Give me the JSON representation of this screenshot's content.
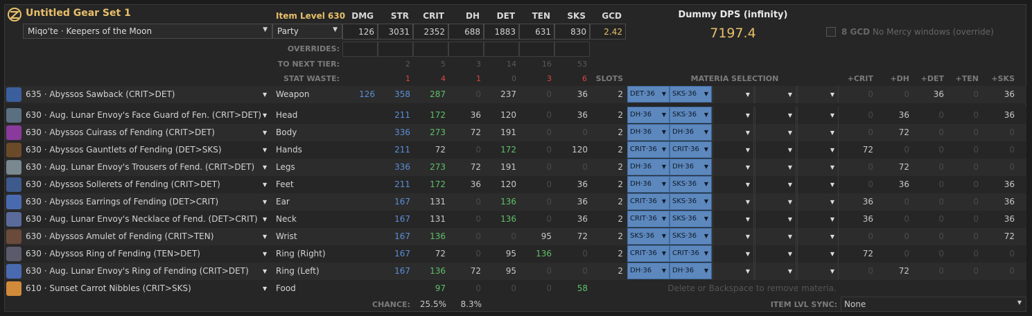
{
  "title": "Untitled Gear Set 1",
  "item_level": "Item Level 630",
  "job": "Miqo'te · Keepers of the Moon",
  "party": "Party",
  "stat_headers": [
    "DMG",
    "STR",
    "CRIT",
    "DH",
    "DET",
    "TEN",
    "SKS",
    "GCD"
  ],
  "stat_values": [
    "126",
    "3031",
    "2352",
    "688",
    "1883",
    "631",
    "830",
    "2.42"
  ],
  "overrides_label": "OVERRIDES:",
  "next_tier_label": "TO NEXT TIER:",
  "next_tier": [
    "2",
    "5",
    "3",
    "14",
    "16",
    "53"
  ],
  "waste_label": "STAT WASTE:",
  "waste": [
    "1",
    "4",
    "1",
    "0",
    "3",
    "6"
  ],
  "slots_label": "SLOTS",
  "materia_label": "MATERIA SELECTION",
  "bonus_headers": [
    "+CRIT",
    "+DH",
    "+DET",
    "+TEN",
    "+SKS"
  ],
  "dps_title": "Dummy DPS (infinity)",
  "dps_value": "7197.4",
  "gcd_option_bold": "8 GCD",
  "gcd_option_text": "No Mercy windows (override)",
  "colors": {
    "accent": "#e8c06a",
    "materia": "#5d88bd",
    "base_stat": "#5b8fd6",
    "bonus": "#5fc06a",
    "waste": "#e04545"
  },
  "rows": [
    {
      "name": "635 · Abyssos Sawback (CRIT>DET)",
      "slot": "Weapon",
      "dmg": "126",
      "str": "358",
      "crit": "287",
      "dh": "0",
      "det": "237",
      "ten": "0",
      "sks": "36",
      "slots": "2",
      "m1": "DET·36",
      "m2": "SKS·36",
      "b": [
        "0",
        "0",
        "36",
        "0",
        "36"
      ],
      "icon": "#3a5f9c"
    },
    {
      "name": "630 · Aug. Lunar Envoy's Face Guard of Fen. (CRIT>DET)",
      "slot": "Head",
      "dmg": "",
      "str": "211",
      "crit": "172",
      "dh": "36",
      "det": "120",
      "ten": "0",
      "sks": "36",
      "slots": "2",
      "m1": "DH·36",
      "m2": "SKS·36",
      "b": [
        "0",
        "36",
        "0",
        "0",
        "36"
      ],
      "icon": "#5a7080"
    },
    {
      "name": "630 · Abyssos Cuirass of Fending (CRIT>DET)",
      "slot": "Body",
      "dmg": "",
      "str": "336",
      "crit": "273",
      "dh": "72",
      "det": "191",
      "ten": "0",
      "sks": "0",
      "slots": "2",
      "m1": "DH·36",
      "m2": "DH·36",
      "b": [
        "0",
        "72",
        "0",
        "0",
        "0"
      ],
      "icon": "#8a3a9c"
    },
    {
      "name": "630 · Abyssos Gauntlets of Fending (DET>SKS)",
      "slot": "Hands",
      "dmg": "",
      "str": "211",
      "crit": "72",
      "dh": "0",
      "det": "172",
      "ten": "0",
      "sks": "120",
      "slots": "2",
      "m1": "CRIT·36",
      "m2": "CRIT·36",
      "b": [
        "72",
        "0",
        "0",
        "0",
        "0"
      ],
      "icon": "#6b4a2a"
    },
    {
      "name": "630 · Aug. Lunar Envoy's Trousers of Fend. (CRIT>DET)",
      "slot": "Legs",
      "dmg": "",
      "str": "336",
      "crit": "273",
      "dh": "72",
      "det": "191",
      "ten": "0",
      "sks": "0",
      "slots": "2",
      "m1": "DH·36",
      "m2": "DH·36",
      "b": [
        "0",
        "72",
        "0",
        "0",
        "0"
      ],
      "icon": "#7a8890"
    },
    {
      "name": "630 · Abyssos Sollerets of Fending (CRIT>DET)",
      "slot": "Feet",
      "dmg": "",
      "str": "211",
      "crit": "172",
      "dh": "36",
      "det": "120",
      "ten": "0",
      "sks": "36",
      "slots": "2",
      "m1": "DH·36",
      "m2": "SKS·36",
      "b": [
        "0",
        "36",
        "0",
        "0",
        "36"
      ],
      "icon": "#3e5a8c"
    },
    {
      "name": "630 · Abyssos Earrings of Fending (DET>CRIT)",
      "slot": "Ear",
      "dmg": "",
      "str": "167",
      "crit": "131",
      "dh": "0",
      "det": "136",
      "ten": "0",
      "sks": "36",
      "slots": "2",
      "m1": "CRIT·36",
      "m2": "SKS·36",
      "b": [
        "36",
        "0",
        "0",
        "0",
        "36"
      ],
      "icon": "#4a6ab0"
    },
    {
      "name": "630 · Aug. Lunar Envoy's Necklace of Fend. (DET>CRIT)",
      "slot": "Neck",
      "dmg": "",
      "str": "167",
      "crit": "131",
      "dh": "0",
      "det": "136",
      "ten": "0",
      "sks": "36",
      "slots": "2",
      "m1": "CRIT·36",
      "m2": "SKS·36",
      "b": [
        "36",
        "0",
        "0",
        "0",
        "36"
      ],
      "icon": "#5a6a9a"
    },
    {
      "name": "630 · Abyssos Amulet of Fending (CRIT>TEN)",
      "slot": "Wrist",
      "dmg": "",
      "str": "167",
      "crit": "136",
      "dh": "0",
      "det": "0",
      "ten": "95",
      "sks": "72",
      "slots": "2",
      "m1": "SKS·36",
      "m2": "SKS·36",
      "b": [
        "0",
        "0",
        "0",
        "0",
        "72"
      ],
      "icon": "#6a4a3a"
    },
    {
      "name": "630 · Abyssos Ring of Fending (TEN>DET)",
      "slot": "Ring (Right)",
      "dmg": "",
      "str": "167",
      "crit": "72",
      "dh": "0",
      "det": "95",
      "ten": "136",
      "sks": "0",
      "slots": "2",
      "m1": "CRIT·36",
      "m2": "CRIT·36",
      "b": [
        "72",
        "0",
        "0",
        "0",
        "0"
      ],
      "icon": "#5a5a6a"
    },
    {
      "name": "630 · Aug. Lunar Envoy's Ring of Fending (CRIT>DET)",
      "slot": "Ring (Left)",
      "dmg": "",
      "str": "167",
      "crit": "136",
      "dh": "72",
      "det": "95",
      "ten": "0",
      "sks": "0",
      "slots": "2",
      "m1": "DH·36",
      "m2": "DH·36",
      "b": [
        "0",
        "72",
        "0",
        "0",
        "0"
      ],
      "icon": "#4a6ab0"
    },
    {
      "name": "610 · Sunset Carrot Nibbles (CRIT>SKS)",
      "slot": "Food",
      "dmg": "",
      "str": "",
      "crit": "97",
      "dh": "0",
      "det": "0",
      "ten": "0",
      "sks": "58",
      "slots": "",
      "m1": "",
      "m2": "",
      "b": [
        "",
        "",
        "",
        "",
        ""
      ],
      "icon": "#d08a3a"
    }
  ],
  "food_hint": "Delete or Backspace to remove materia.",
  "chance_label": "CHANCE:",
  "chance_crit": "25.5%",
  "chance_dh": "8.3%",
  "sync_label": "ITEM LVL SYNC:",
  "sync_value": "None"
}
